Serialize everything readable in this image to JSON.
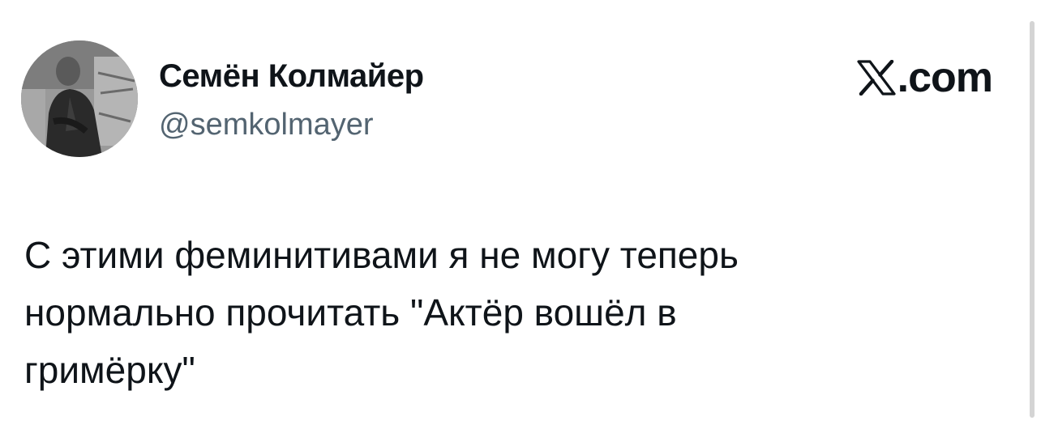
{
  "author": {
    "display_name": "Семён Колмайер",
    "handle": "@semkolmayer",
    "avatar_icon": "profile-photo"
  },
  "brand": {
    "icon": "x-logo-icon",
    "text": ".com"
  },
  "tweet": {
    "lines": [
      "С этими феминитивами я не могу теперь",
      "нормально прочитать \"Актёр вошёл в",
      "гримёрку\""
    ]
  },
  "colors": {
    "text_primary": "#0f1419",
    "text_secondary": "#536471",
    "background": "#ffffff"
  }
}
